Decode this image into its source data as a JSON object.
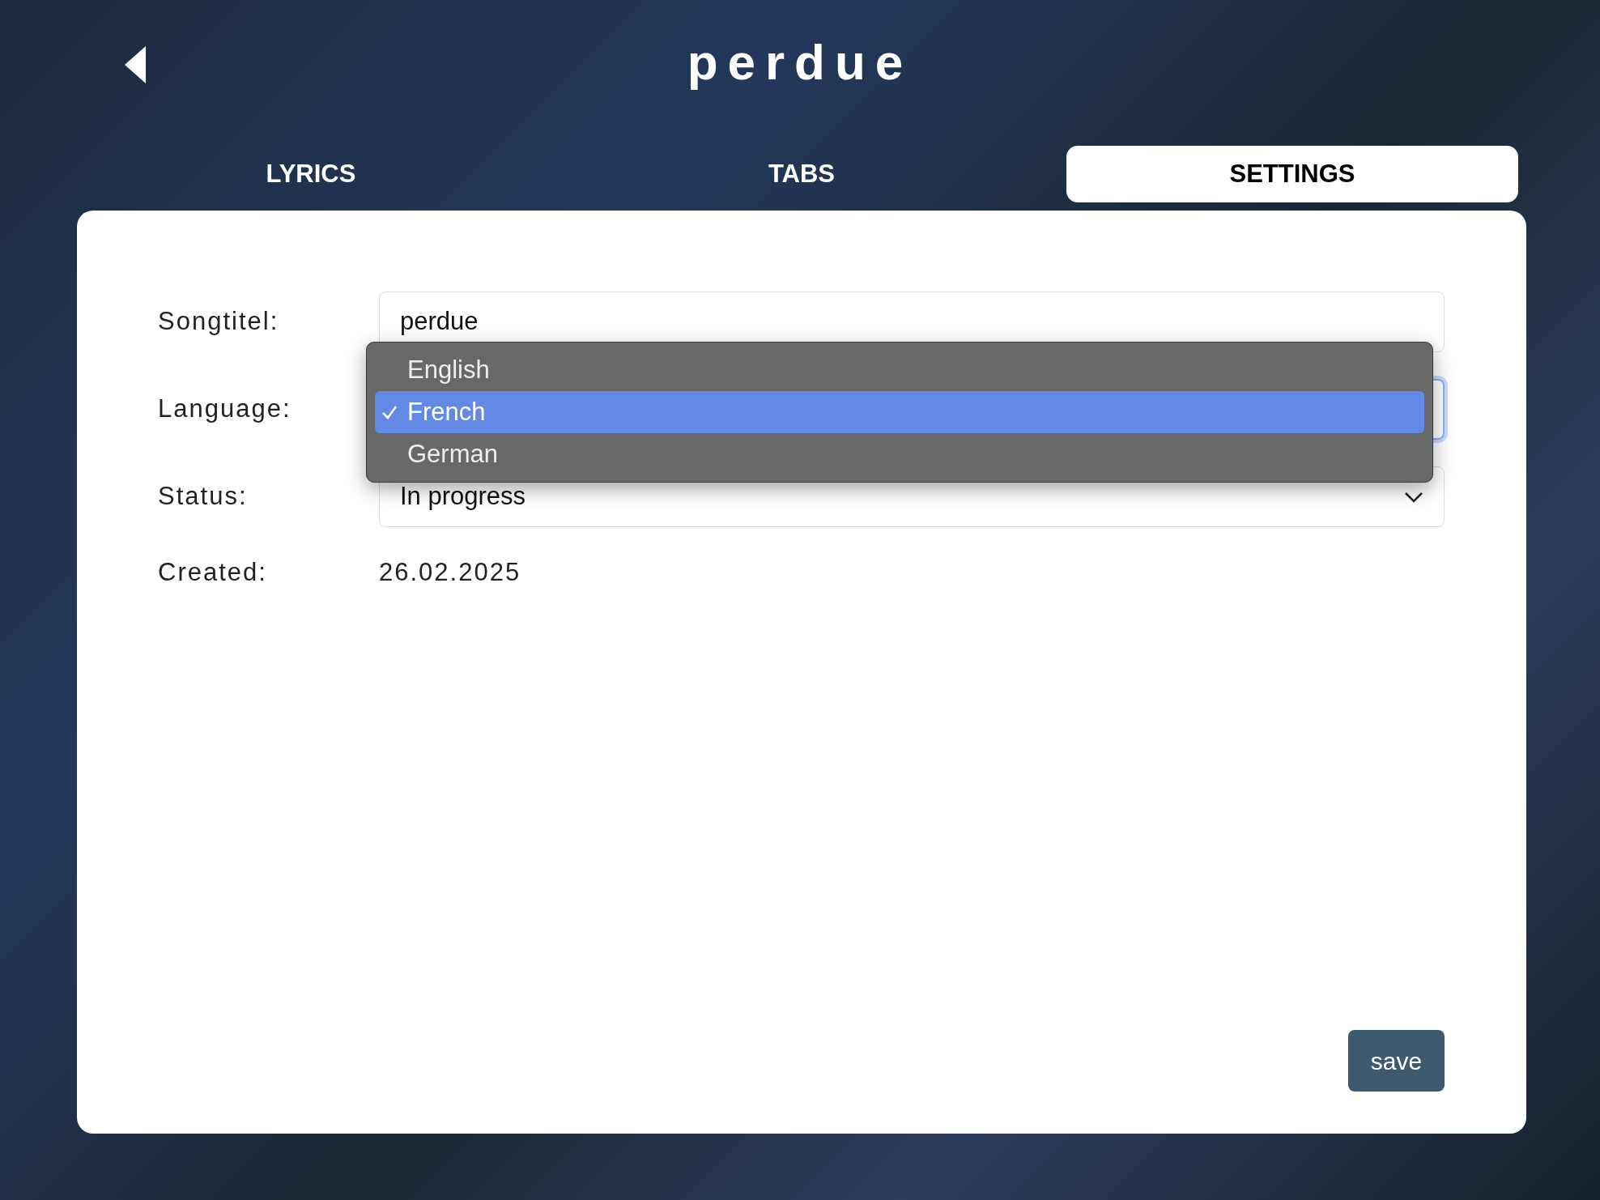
{
  "header": {
    "title": "perdue"
  },
  "tabs": [
    {
      "label": "LYRICS",
      "selected": false
    },
    {
      "label": "TABS",
      "selected": false
    },
    {
      "label": "SETTINGS",
      "selected": true
    }
  ],
  "form": {
    "fields": [
      {
        "kind": "text",
        "label": "Songtitel:",
        "value": "perdue"
      },
      {
        "kind": "select",
        "label": "Language:",
        "focused": true,
        "options": [
          {
            "label": "English",
            "selected": false
          },
          {
            "label": "French",
            "selected": true
          },
          {
            "label": "German",
            "selected": false
          }
        ]
      },
      {
        "kind": "select",
        "label": "Status:",
        "value": "In progress"
      },
      {
        "kind": "static",
        "label": "Created:",
        "value": "26.02.2025"
      }
    ]
  },
  "save_button": {
    "label": "save"
  }
}
